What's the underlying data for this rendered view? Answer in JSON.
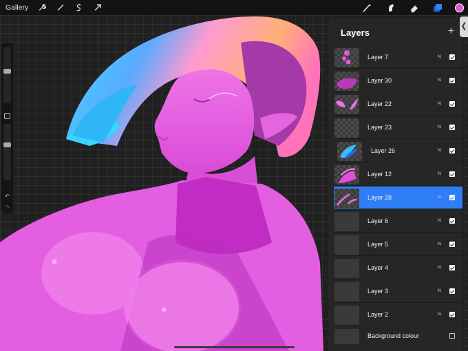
{
  "toolbar": {
    "gallery_label": "Gallery",
    "left_icons": [
      "wrench-icon",
      "magic-wand-icon",
      "selection-icon",
      "transform-arrow-icon"
    ],
    "right_icons": [
      "brush-icon",
      "smudge-icon",
      "eraser-icon",
      "layers-icon"
    ],
    "current_color": "#e054d0"
  },
  "sidebar": {
    "brush_size_level": 0.43,
    "opacity_level": 0.36
  },
  "layers": {
    "title": "Layers",
    "add_symbol": "+",
    "rows": [
      {
        "name": "Layer 7",
        "blend": "N",
        "visible": true,
        "thumb": "pink-dots"
      },
      {
        "name": "Layer 30",
        "blend": "N",
        "visible": true,
        "thumb": "purple-blob"
      },
      {
        "name": "Layer 22",
        "blend": "N",
        "visible": true,
        "thumb": "pink-wings"
      },
      {
        "name": "Layer 23",
        "blend": "N",
        "visible": true,
        "thumb": "empty-checker"
      },
      {
        "name": "Layer 26",
        "blend": "N",
        "visible": true,
        "thumb": "blue-hair"
      },
      {
        "name": "Layer 12",
        "blend": "N",
        "visible": true,
        "thumb": "pink-figure"
      },
      {
        "name": "Layer 28",
        "blend": "N",
        "visible": true,
        "thumb": "pink-lines",
        "selected": true
      },
      {
        "name": "Layer 6",
        "blend": "N",
        "visible": true,
        "thumb": "plain"
      },
      {
        "name": "Layer 5",
        "blend": "N",
        "visible": true,
        "thumb": "plain"
      },
      {
        "name": "Layer 4",
        "blend": "N",
        "visible": true,
        "thumb": "plain"
      },
      {
        "name": "Layer 3",
        "blend": "N",
        "visible": true,
        "thumb": "plain"
      },
      {
        "name": "Layer 2",
        "blend": "N",
        "visible": true,
        "thumb": "plain"
      }
    ],
    "background": {
      "name": "Background colour",
      "visible": false
    }
  },
  "colors": {
    "selection": "#2f7ef6",
    "panel": "#262626",
    "skin": "#e35ee0"
  }
}
